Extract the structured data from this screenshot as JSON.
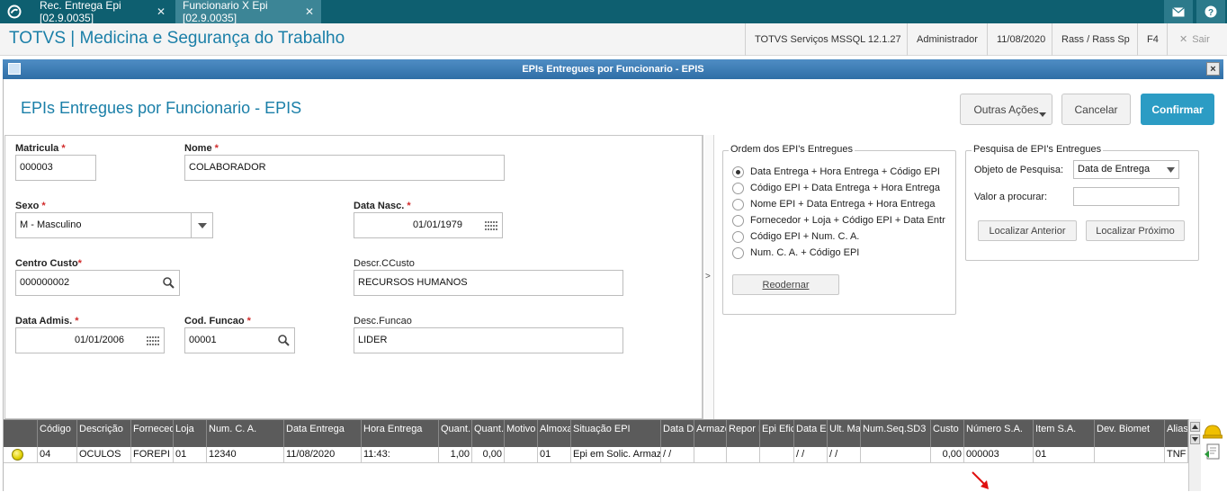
{
  "topbar": {
    "tabs": [
      {
        "label": "Rec. Entrega Epi [02.9.0035]",
        "close": "✕"
      },
      {
        "label": "Funcionario X Epi [02.9.0035]",
        "close": "✕"
      }
    ]
  },
  "appbar": {
    "title": "TOTVS | Medicina e Segurança do Trabalho",
    "server": "TOTVS Serviços MSSQL 12.1.27",
    "user": "Administrador",
    "date": "11/08/2020",
    "branch": "Rass / Rass Sp",
    "shortcut": "F4",
    "exit": "Sair"
  },
  "window": {
    "title": "EPIs Entregues por Funcionario - EPIS",
    "close": "×"
  },
  "page": {
    "title": "EPIs Entregues por Funcionario - EPIS",
    "actions": {
      "other": "Outras Ações",
      "cancel": "Cancelar",
      "confirm": "Confirmar"
    }
  },
  "form": {
    "matricula": {
      "label": "Matricula",
      "value": "000003"
    },
    "nome": {
      "label": "Nome",
      "value": "COLABORADOR"
    },
    "sexo": {
      "label": "Sexo",
      "value": "M - Masculino"
    },
    "data_nasc": {
      "label": "Data Nasc.",
      "value": "01/01/1979"
    },
    "centro_custo": {
      "label": "Centro Custo",
      "value": "000000002"
    },
    "descr_ccusto": {
      "label": "Descr.CCusto",
      "value": "RECURSOS HUMANOS"
    },
    "data_admis": {
      "label": "Data Admis.",
      "value": "01/01/2006"
    },
    "cod_funcao": {
      "label": "Cod. Funcao",
      "value": "00001"
    },
    "desc_funcao": {
      "label": "Desc.Funcao",
      "value": "LIDER"
    },
    "required_mark": "*"
  },
  "splitter": ">",
  "ordem": {
    "title": "Ordem dos EPI's Entregues",
    "options": [
      "Data Entrega + Hora Entrega + Código EPI",
      "Código EPI + Data Entrega + Hora Entrega",
      "Nome EPI + Data Entrega + Hora Entrega",
      "Fornecedor + Loja + Código EPI + Data Entr",
      "Código EPI +  Num. C. A.",
      "Num. C. A. + Código EPI"
    ],
    "selected_index": 0,
    "reorder_button": "Reodernar"
  },
  "pesquisa": {
    "title": "Pesquisa de EPI's Entregues",
    "objeto_label": "Objeto de Pesquisa:",
    "objeto_value": "Data de Entrega",
    "valor_label": "Valor a procurar:",
    "valor_value": "",
    "prev_button": "Localizar Anterior",
    "next_button": "Localizar Próximo"
  },
  "grid": {
    "columns": [
      "",
      "Código",
      "Descrição",
      "Forneced",
      "Loja",
      "Num. C. A.",
      "Data Entrega",
      "Hora Entrega",
      "Quant.",
      "Quant.D",
      "Motivo",
      "Almoxa",
      "Situação EPI",
      "Data De",
      "Armaze",
      "Repor E",
      "Epi Efic",
      "Data En",
      "Ult. Mar",
      "Num.Seq.SD3",
      "Custo",
      "Número S.A.",
      "Item S.A.",
      "Dev. Biomet",
      "Alias"
    ],
    "rows": [
      [
        "",
        "04",
        "OCULOS",
        "FOREPI",
        "01",
        "12340",
        "11/08/2020",
        "11:43:",
        "1,00",
        "0,00",
        "",
        "01",
        "Epi em Solic. Armaze",
        " / /",
        "",
        "",
        "",
        " / /",
        " / /",
        "",
        "0,00",
        "000003",
        "01",
        "",
        "TNF"
      ]
    ],
    "status_color": "#e8dc00"
  },
  "colors": {
    "accent": "#1a7fa8",
    "confirm": "#2c9cc4",
    "topbar": "#0e5f70",
    "required": "#d12b2b",
    "annotation": "#e01010"
  }
}
